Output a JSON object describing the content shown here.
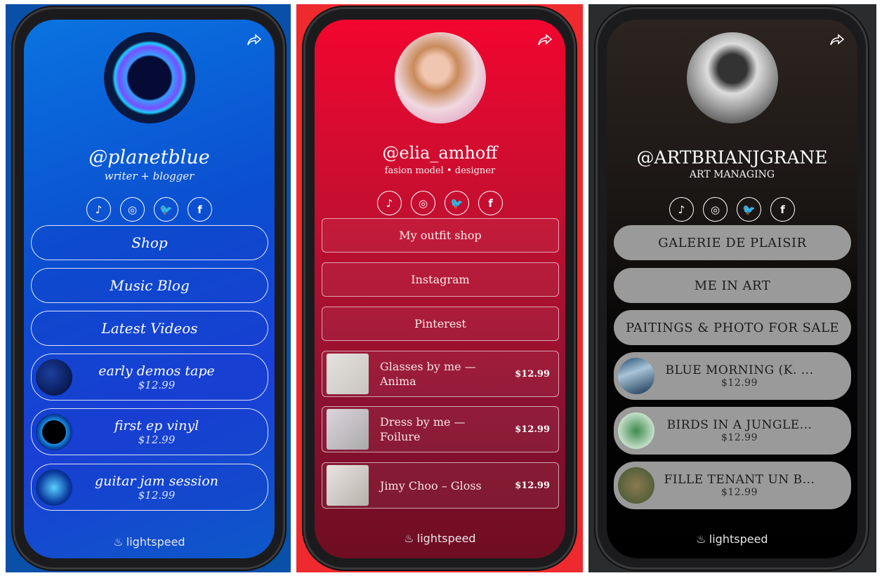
{
  "phones": [
    {
      "theme": "blue",
      "background": "#0a4fa8",
      "screen_color": "#0b5fd6",
      "handle": "@planetblue",
      "bio": "writer + blogger",
      "socials": [
        "tiktok-icon",
        "instagram-icon",
        "twitter-icon",
        "facebook-icon"
      ],
      "links": [
        "Shop",
        "Music Blog",
        "Latest Videos"
      ],
      "products": [
        {
          "name": "early demos tape",
          "price": "$12.99"
        },
        {
          "name": "first ep vinyl",
          "price": "$12.99"
        },
        {
          "name": "guitar jam session",
          "price": "$12.99"
        }
      ],
      "footer": "lightspeed"
    },
    {
      "theme": "red",
      "background": "#ee2a2f",
      "screen_color": "#c8102e",
      "handle": "@elia_amhoff",
      "bio": "fasion model • designer",
      "socials": [
        "tiktok-icon",
        "instagram-icon",
        "twitter-icon",
        "facebook-icon"
      ],
      "links": [
        "My outfit shop",
        "Instagram",
        "Pinterest"
      ],
      "products": [
        {
          "name": "Glasses by me — Anima",
          "price": "$12.99"
        },
        {
          "name": "Dress by me — Foilure",
          "price": "$12.99"
        },
        {
          "name": "Jimy Choo – Gloss",
          "price": "$12.99"
        }
      ],
      "footer": "lightspeed"
    },
    {
      "theme": "dark",
      "background": "#2a2c2e",
      "screen_color": "#0a0a0a",
      "handle": "@ARTBRIANJGRANE",
      "bio": "ART MANAGING",
      "socials": [
        "tiktok-icon",
        "instagram-icon",
        "twitter-icon",
        "facebook-icon"
      ],
      "links": [
        "GALERIE DE PLAISIR",
        "ME IN ART",
        "PAITINGS & PHOTO FOR SALE"
      ],
      "products": [
        {
          "name": "BLUE MORNING (K. ...",
          "price": "$12.99"
        },
        {
          "name": "BIRDS IN A JUNGLE...",
          "price": "$12.99"
        },
        {
          "name": "FILLE TENANT UN B...",
          "price": "$12.99"
        }
      ],
      "footer": "lightspeed"
    }
  ]
}
